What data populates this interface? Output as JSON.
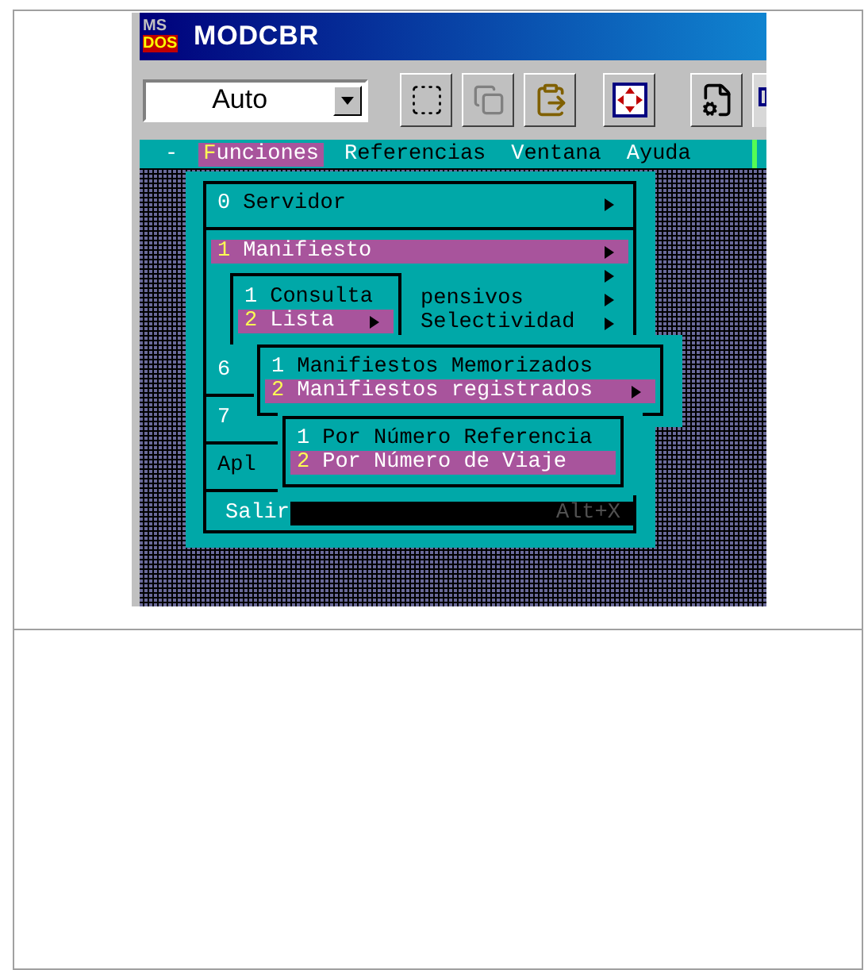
{
  "window": {
    "title": "MODCBR",
    "logo": [
      "MS",
      "DOS"
    ]
  },
  "toolbar": {
    "font_size": "Auto"
  },
  "menu_bar": [
    {
      "label": "-",
      "selected": false
    },
    {
      "label": "Funciones",
      "selected": true
    },
    {
      "label": "Referencias",
      "selected": false
    },
    {
      "label": "Ventana",
      "selected": false
    },
    {
      "label": "Ayuda",
      "selected": false
    }
  ],
  "functions_menu": [
    {
      "kind": "item",
      "key": "0",
      "label": "Servidor",
      "submenu": true,
      "selected": false
    },
    {
      "kind": "separator"
    },
    {
      "kind": "item",
      "key": "1",
      "label": "Manifiesto",
      "submenu": true,
      "selected": true
    },
    {
      "kind": "tail",
      "submenu": true
    },
    {
      "kind": "tail",
      "label": "pensivos",
      "submenu": true
    },
    {
      "kind": "tail",
      "label": "Selectividad",
      "submenu": true
    },
    {
      "kind": "blank"
    },
    {
      "kind": "item",
      "key": "6",
      "submenu": false,
      "selected": false
    },
    {
      "kind": "separator"
    },
    {
      "kind": "item",
      "key": "7",
      "submenu": false,
      "selected": false
    },
    {
      "kind": "separator"
    },
    {
      "kind": "item",
      "label": "Apl",
      "submenu": false,
      "selected": false
    },
    {
      "kind": "separator"
    },
    {
      "kind": "exit",
      "label": "Salir",
      "shortcut": "Alt+X"
    }
  ],
  "submenus": [
    {
      "items": [
        {
          "key": "1",
          "label": "Consulta",
          "submenu": false,
          "selected": false
        },
        {
          "key": "2",
          "label": "Lista",
          "submenu": true,
          "selected": true
        }
      ]
    },
    {
      "items": [
        {
          "key": "1",
          "label": "Manifiestos Memorizados",
          "submenu": false,
          "selected": false
        },
        {
          "key": "2",
          "label": "Manifiestos registrados",
          "submenu": true,
          "selected": true
        }
      ]
    },
    {
      "items": [
        {
          "key": "1",
          "label": "Por Número Referencia",
          "submenu": false,
          "selected": false
        },
        {
          "key": "2",
          "label": "Por Número de Viaje",
          "submenu": false,
          "selected": true
        }
      ]
    }
  ]
}
